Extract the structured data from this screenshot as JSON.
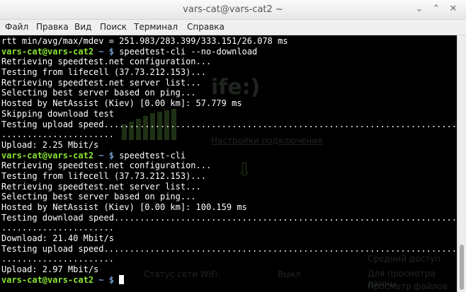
{
  "window": {
    "title": "vars-cat@vars-cat2 ~",
    "minimize_glyph": "⌄",
    "maximize_glyph": "⌃",
    "close_glyph": "✕"
  },
  "menu": [
    "Файл",
    "Правка",
    "Вид",
    "Поиск",
    "Терминал",
    "Справка"
  ],
  "prompt": {
    "user": "vars-cat@vars-cat2",
    "sep": " ~ ",
    "dollar": "$"
  },
  "background_window": {
    "big_text": "ife:)",
    "link1": "Настройки подключения",
    "status_label": "Статус сети WiFi:",
    "status_value": "Выкл",
    "right1": "Средний доступ",
    "right2": "Для просмотра данны",
    "right3": "Просмотр файлов на"
  },
  "terminal": {
    "lines": [
      {
        "type": "output",
        "text": "rtt min/avg/max/mdev = 251.983/283.399/333.151/26.078 ms"
      },
      {
        "type": "prompt",
        "command": "speedtest-cli --no-download"
      },
      {
        "type": "output",
        "text": "Retrieving speedtest.net configuration..."
      },
      {
        "type": "output",
        "text": "Testing from lifecell (37.73.212.153)..."
      },
      {
        "type": "output",
        "text": "Retrieving speedtest.net server list..."
      },
      {
        "type": "output",
        "text": "Selecting best server based on ping..."
      },
      {
        "type": "output",
        "text": "Hosted by NetAssist (Kiev) [0.00 km]: 57.779 ms"
      },
      {
        "type": "output",
        "text": "Skipping download test"
      },
      {
        "type": "output",
        "text": "Testing upload speed............................................................................................"
      },
      {
        "type": "output",
        "text": "......................"
      },
      {
        "type": "output",
        "text": "Upload: 2.25 Mbit/s"
      },
      {
        "type": "prompt",
        "command": "speedtest-cli"
      },
      {
        "type": "output",
        "text": "Retrieving speedtest.net configuration..."
      },
      {
        "type": "output",
        "text": "Testing from lifecell (37.73.212.153)..."
      },
      {
        "type": "output",
        "text": "Retrieving speedtest.net server list..."
      },
      {
        "type": "output",
        "text": "Selecting best server based on ping..."
      },
      {
        "type": "output",
        "text": "Hosted by NetAssist (Kiev) [0.00 km]: 100.159 ms"
      },
      {
        "type": "output",
        "text": "Testing download speed.........................................................................................."
      },
      {
        "type": "output",
        "text": "......................"
      },
      {
        "type": "output",
        "text": "Download: 21.40 Mbit/s"
      },
      {
        "type": "output",
        "text": "Testing upload speed............................................................................................"
      },
      {
        "type": "output",
        "text": "......................"
      },
      {
        "type": "output",
        "text": "Upload: 2.97 Mbit/s"
      },
      {
        "type": "prompt",
        "command": "",
        "cursor": true
      }
    ]
  },
  "colors": {
    "prompt_user": "#8ae234",
    "prompt_path": "#729fcf",
    "terminal_text": "#ffffff",
    "terminal_bg": "#000000"
  }
}
